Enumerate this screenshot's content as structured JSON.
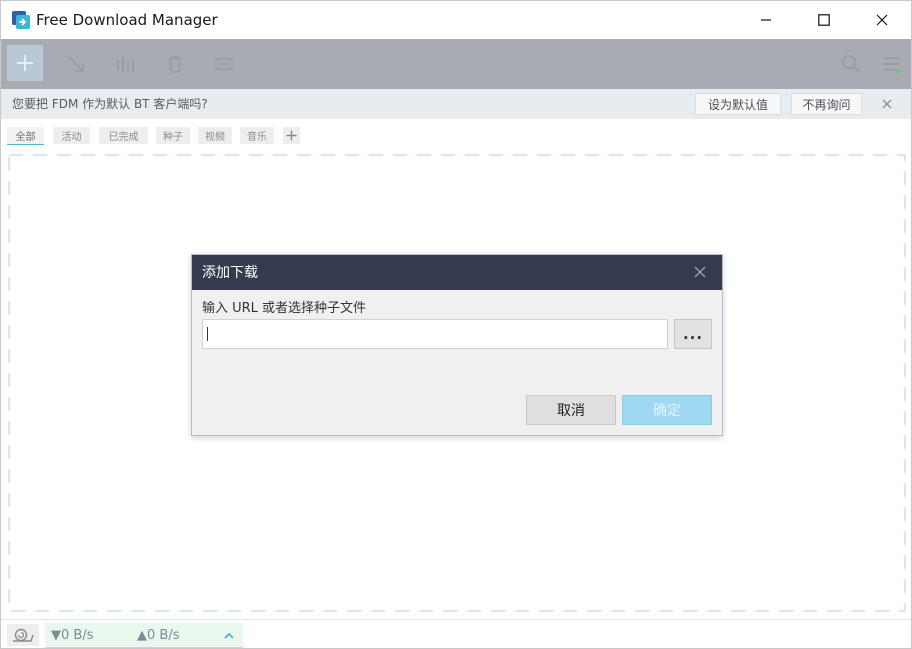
{
  "window": {
    "title": "Free Download Manager"
  },
  "notification": {
    "text": "您要把 FDM 作为默认 BT 客户端吗?",
    "set_default_label": "设为默认值",
    "dont_ask_label": "不再询问"
  },
  "filter_tabs": [
    {
      "label": "全部",
      "active": true
    },
    {
      "label": "活动",
      "active": false
    },
    {
      "label": "已完成",
      "active": false
    },
    {
      "label": "种子",
      "active": false
    },
    {
      "label": "视频",
      "active": false
    },
    {
      "label": "音乐",
      "active": false
    }
  ],
  "statusbar": {
    "download_speed": "▼0 B/s",
    "upload_speed": "▲0 B/s"
  },
  "dialog": {
    "title": "添加下载",
    "label": "输入 URL 或者选择种子文件",
    "url_value": "",
    "browse_label": "...",
    "cancel_label": "取消",
    "ok_label": "确定"
  },
  "colors": {
    "dialog_header": "#343b4e",
    "accent": "#48b8cc",
    "ok_button": "#9fd8f2",
    "toolbar_overlay": "#a8abb1"
  },
  "icons": [
    "app-logo-icon",
    "minimize-icon",
    "maximize-icon",
    "close-icon",
    "add-icon",
    "move-icon",
    "stats-icon",
    "trash-icon",
    "tag-icon",
    "search-icon",
    "menu-icon",
    "snail-icon",
    "chevron-up-icon"
  ]
}
